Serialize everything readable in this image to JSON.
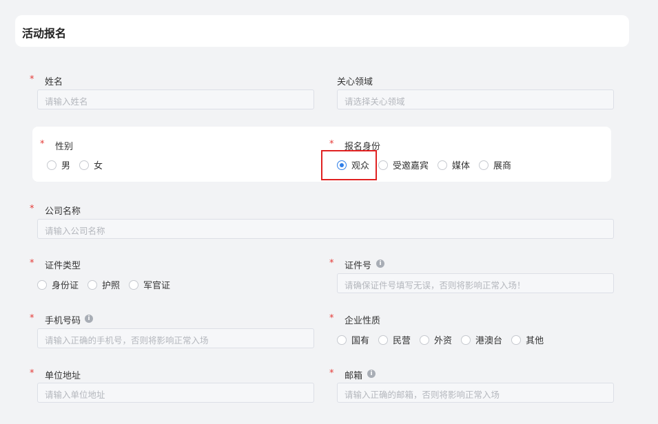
{
  "header": {
    "title": "活动报名"
  },
  "required_mark": "*",
  "form": {
    "name": {
      "label": "姓名",
      "placeholder": "请输入姓名"
    },
    "interest": {
      "label": "关心领域",
      "placeholder": "请选择关心领域"
    },
    "gender": {
      "label": "性别",
      "options": [
        "男",
        "女"
      ]
    },
    "identity": {
      "label": "报名身份",
      "options": [
        "观众",
        "受邀嘉宾",
        "媒体",
        "展商"
      ],
      "selected": "观众"
    },
    "company": {
      "label": "公司名称",
      "placeholder": "请输入公司名称"
    },
    "id_type": {
      "label": "证件类型",
      "options": [
        "身份证",
        "护照",
        "军官证"
      ]
    },
    "id_number": {
      "label": "证件号",
      "placeholder": "请确保证件号填写无误，否则将影响正常入场！"
    },
    "phone": {
      "label": "手机号码",
      "placeholder": "请输入正确的手机号，否则将影响正常入场"
    },
    "enterprise": {
      "label": "企业性质",
      "options": [
        "国有",
        "民营",
        "外资",
        "港澳台",
        "其他"
      ]
    },
    "address": {
      "label": "单位地址",
      "placeholder": "请输入单位地址"
    },
    "email": {
      "label": "邮箱",
      "placeholder": "请输入正确的邮箱，否则将影响正常入场"
    }
  },
  "info_icon_glyph": "i",
  "colors": {
    "accent": "#2f7fe8",
    "required": "#e53935",
    "highlight": "#e02020"
  }
}
